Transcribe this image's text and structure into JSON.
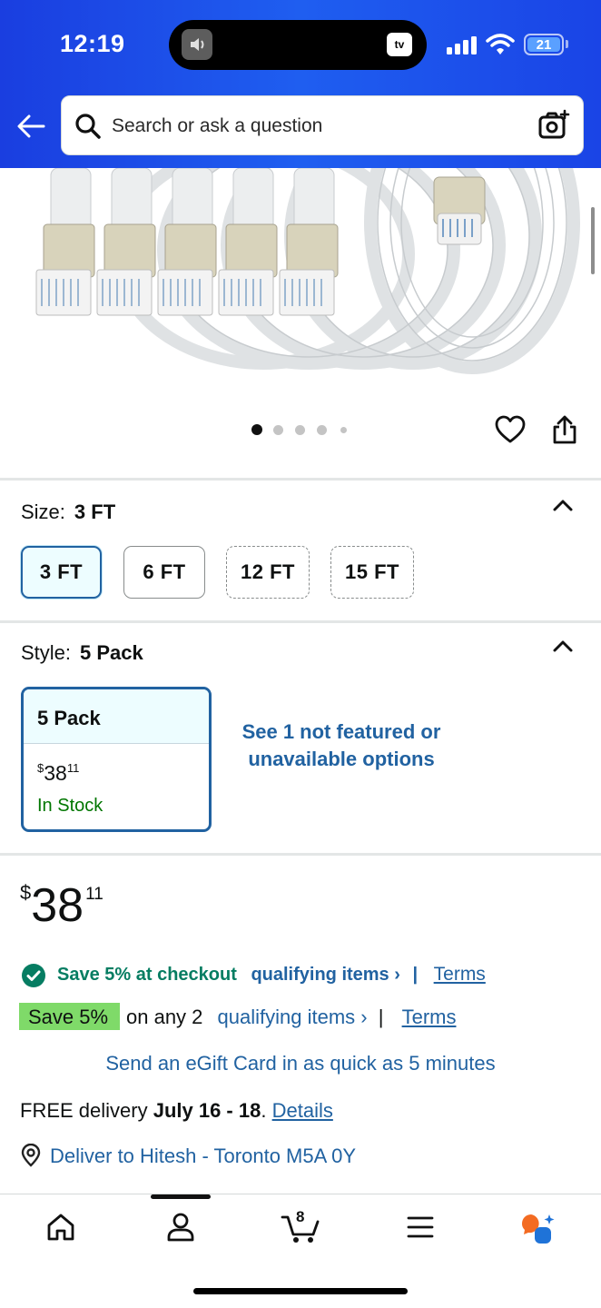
{
  "status_bar": {
    "time": "12:19",
    "tv_label": "tv",
    "battery": "21"
  },
  "search": {
    "placeholder": "Search or ask a question"
  },
  "product": {
    "image_count": 5,
    "active_image": 1
  },
  "size": {
    "label": "Size:",
    "selected": "3 FT",
    "options": [
      "3 FT",
      "6 FT",
      "12 FT",
      "15 FT"
    ]
  },
  "style": {
    "label": "Style:",
    "selected": "5 Pack",
    "card": {
      "name": "5 Pack",
      "currency": "$",
      "price_whole": "38",
      "price_fraction": "11",
      "stock": "In Stock"
    },
    "see_more": "See 1 not featured or unavailable options"
  },
  "price": {
    "currency": "$",
    "whole": "38",
    "fraction": "11"
  },
  "offers": {
    "checkout_text": "Save 5% at checkout",
    "qualifying_1": "qualifying items ›",
    "sep_1": "|",
    "terms_1": "Terms",
    "badge": "Save 5%",
    "on_any": "on any 2",
    "qualifying_2": "qualifying items ›",
    "sep_2": "|",
    "terms_2": "Terms"
  },
  "gift": "Send an eGift Card in as quick as 5 minutes",
  "delivery": {
    "prefix": "FREE delivery",
    "dates": "July 16 - 18",
    "period": ".",
    "details": "Details"
  },
  "deliver_to": "Deliver to Hitesh - Toronto M5A 0Y",
  "tabbar": {
    "cart_count": "8"
  },
  "colors": {
    "header_blue": "#1f5ef0",
    "link": "#2162a1",
    "in_stock": "#007600",
    "save_green": "#067d62",
    "badge_green": "#7fda69"
  }
}
